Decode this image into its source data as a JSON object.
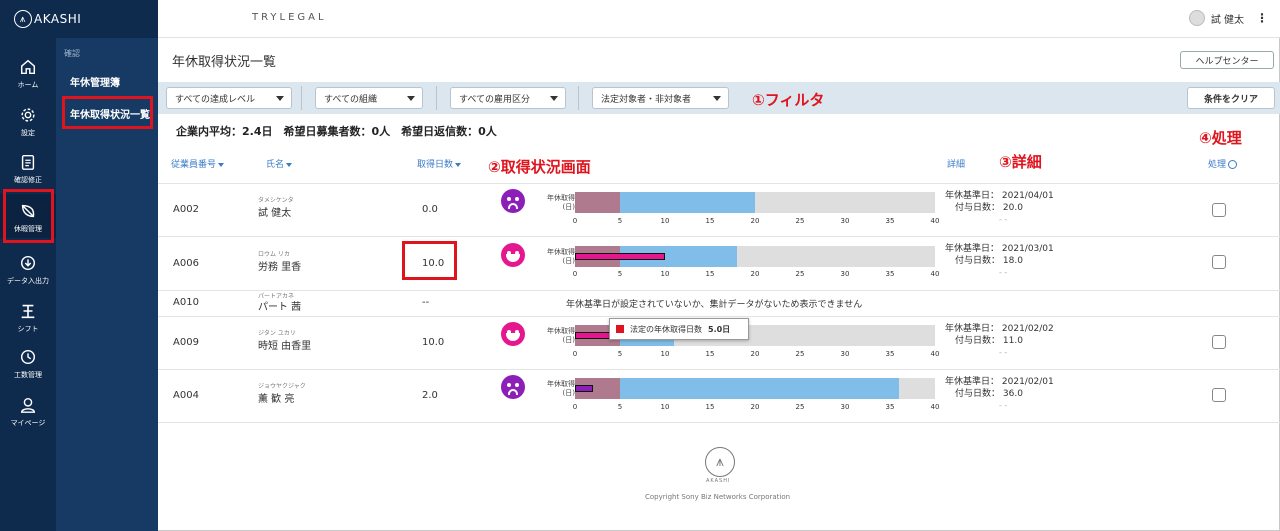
{
  "app": {
    "brand": "AKASHI",
    "product_logo": "TRYLEGAL"
  },
  "user": {
    "name": "試 健太"
  },
  "rail": [
    {
      "label": "ホーム",
      "icon": "home-icon"
    },
    {
      "label": "設定",
      "icon": "gear-icon"
    },
    {
      "label": "確認修正",
      "icon": "clipboard-icon"
    },
    {
      "label": "休暇管理",
      "icon": "leaf-icon"
    },
    {
      "label": "データ入出力",
      "icon": "io-icon"
    },
    {
      "label": "シフト",
      "icon": "shift-icon"
    },
    {
      "label": "工数管理",
      "icon": "clock-icon"
    },
    {
      "label": "マイページ",
      "icon": "person-icon"
    }
  ],
  "subnav": {
    "category": "確認",
    "items": [
      "年休管理簿",
      "年休取得状況一覧"
    ]
  },
  "page": {
    "title": "年休取得状況一覧",
    "help_button": "ヘルプセンター"
  },
  "filters": {
    "achievement": "すべての達成レベル",
    "organization": "すべての組織",
    "employment": "すべての雇用区分",
    "legal": "法定対象者・非対象者",
    "clear_button": "条件をクリア"
  },
  "annotations": {
    "filter": "①フィルタ",
    "status": "②取得状況画面",
    "detail": "③詳細",
    "action": "④処理"
  },
  "summary": "企業内平均：2.4日　希望日募集者数：0人　希望日返信数：0人",
  "table": {
    "headers": {
      "id": "従業員番号",
      "name": "氏名",
      "days": "取得日数",
      "detail": "詳細",
      "action": "処理"
    },
    "graph_label_line1": "年休取得",
    "graph_label_line2": "(日)",
    "ticks": [
      "0",
      "5",
      "10",
      "15",
      "20",
      "25",
      "30",
      "35",
      "40"
    ],
    "no_data_message": "年休基準日が設定されていないか、集計データがないため表示できません",
    "rows": [
      {
        "id": "A002",
        "kana": "タメシケンタ",
        "name": "試 健太",
        "days": "0.0",
        "mood": "sad",
        "mood_color": "#8b1fb8",
        "taken": 0,
        "granted": 20,
        "base_date_label": "年休基準日：",
        "base_date": "2021/04/01",
        "grant_label": "付与日数：",
        "grant": "20.0",
        "dash": "- -"
      },
      {
        "id": "A006",
        "kana": "ロウム リカ",
        "name": "労務 里香",
        "days": "10.0",
        "mood": "happy",
        "mood_color": "#e5178f",
        "taken": 10,
        "granted": 18,
        "base_date_label": "年休基準日：",
        "base_date": "2021/03/01",
        "grant_label": "付与日数：",
        "grant": "18.0",
        "dash": "- -"
      },
      {
        "id": "A010",
        "kana": "パートアカネ",
        "name": "パート 茜",
        "days": "--"
      },
      {
        "id": "A009",
        "kana": "ジタン ユカリ",
        "name": "時短 由香里",
        "days": "10.0",
        "mood": "happy",
        "mood_color": "#e5178f",
        "taken": 10,
        "granted": 11,
        "base_date_label": "年休基準日：",
        "base_date": "2021/02/02",
        "grant_label": "付与日数：",
        "grant": "11.0",
        "dash": "- -"
      },
      {
        "id": "A004",
        "kana": "ジョウヤクジャク",
        "name": "薫 歓 亮",
        "days": "2.0",
        "mood": "sad",
        "mood_color": "#8b1fb8",
        "taken": 2,
        "granted": 36,
        "base_date_label": "年休基準日：",
        "base_date": "2021/02/01",
        "grant_label": "付与日数：",
        "grant": "36.0",
        "dash": "- -"
      }
    ]
  },
  "tooltip": {
    "label": "法定の年休取得日数",
    "value": "5.0日"
  },
  "footer": {
    "brand": "AKASHI",
    "copyright": "Copyright Sony Biz Networks Corporation"
  },
  "colors": {
    "nav": "#0e2a4d",
    "subnav": "#163a63",
    "accent": "#3a7bc8",
    "highlight": "#e0141e",
    "legal_zone": "#b07a8e",
    "granted_bar": "#80bde8"
  }
}
